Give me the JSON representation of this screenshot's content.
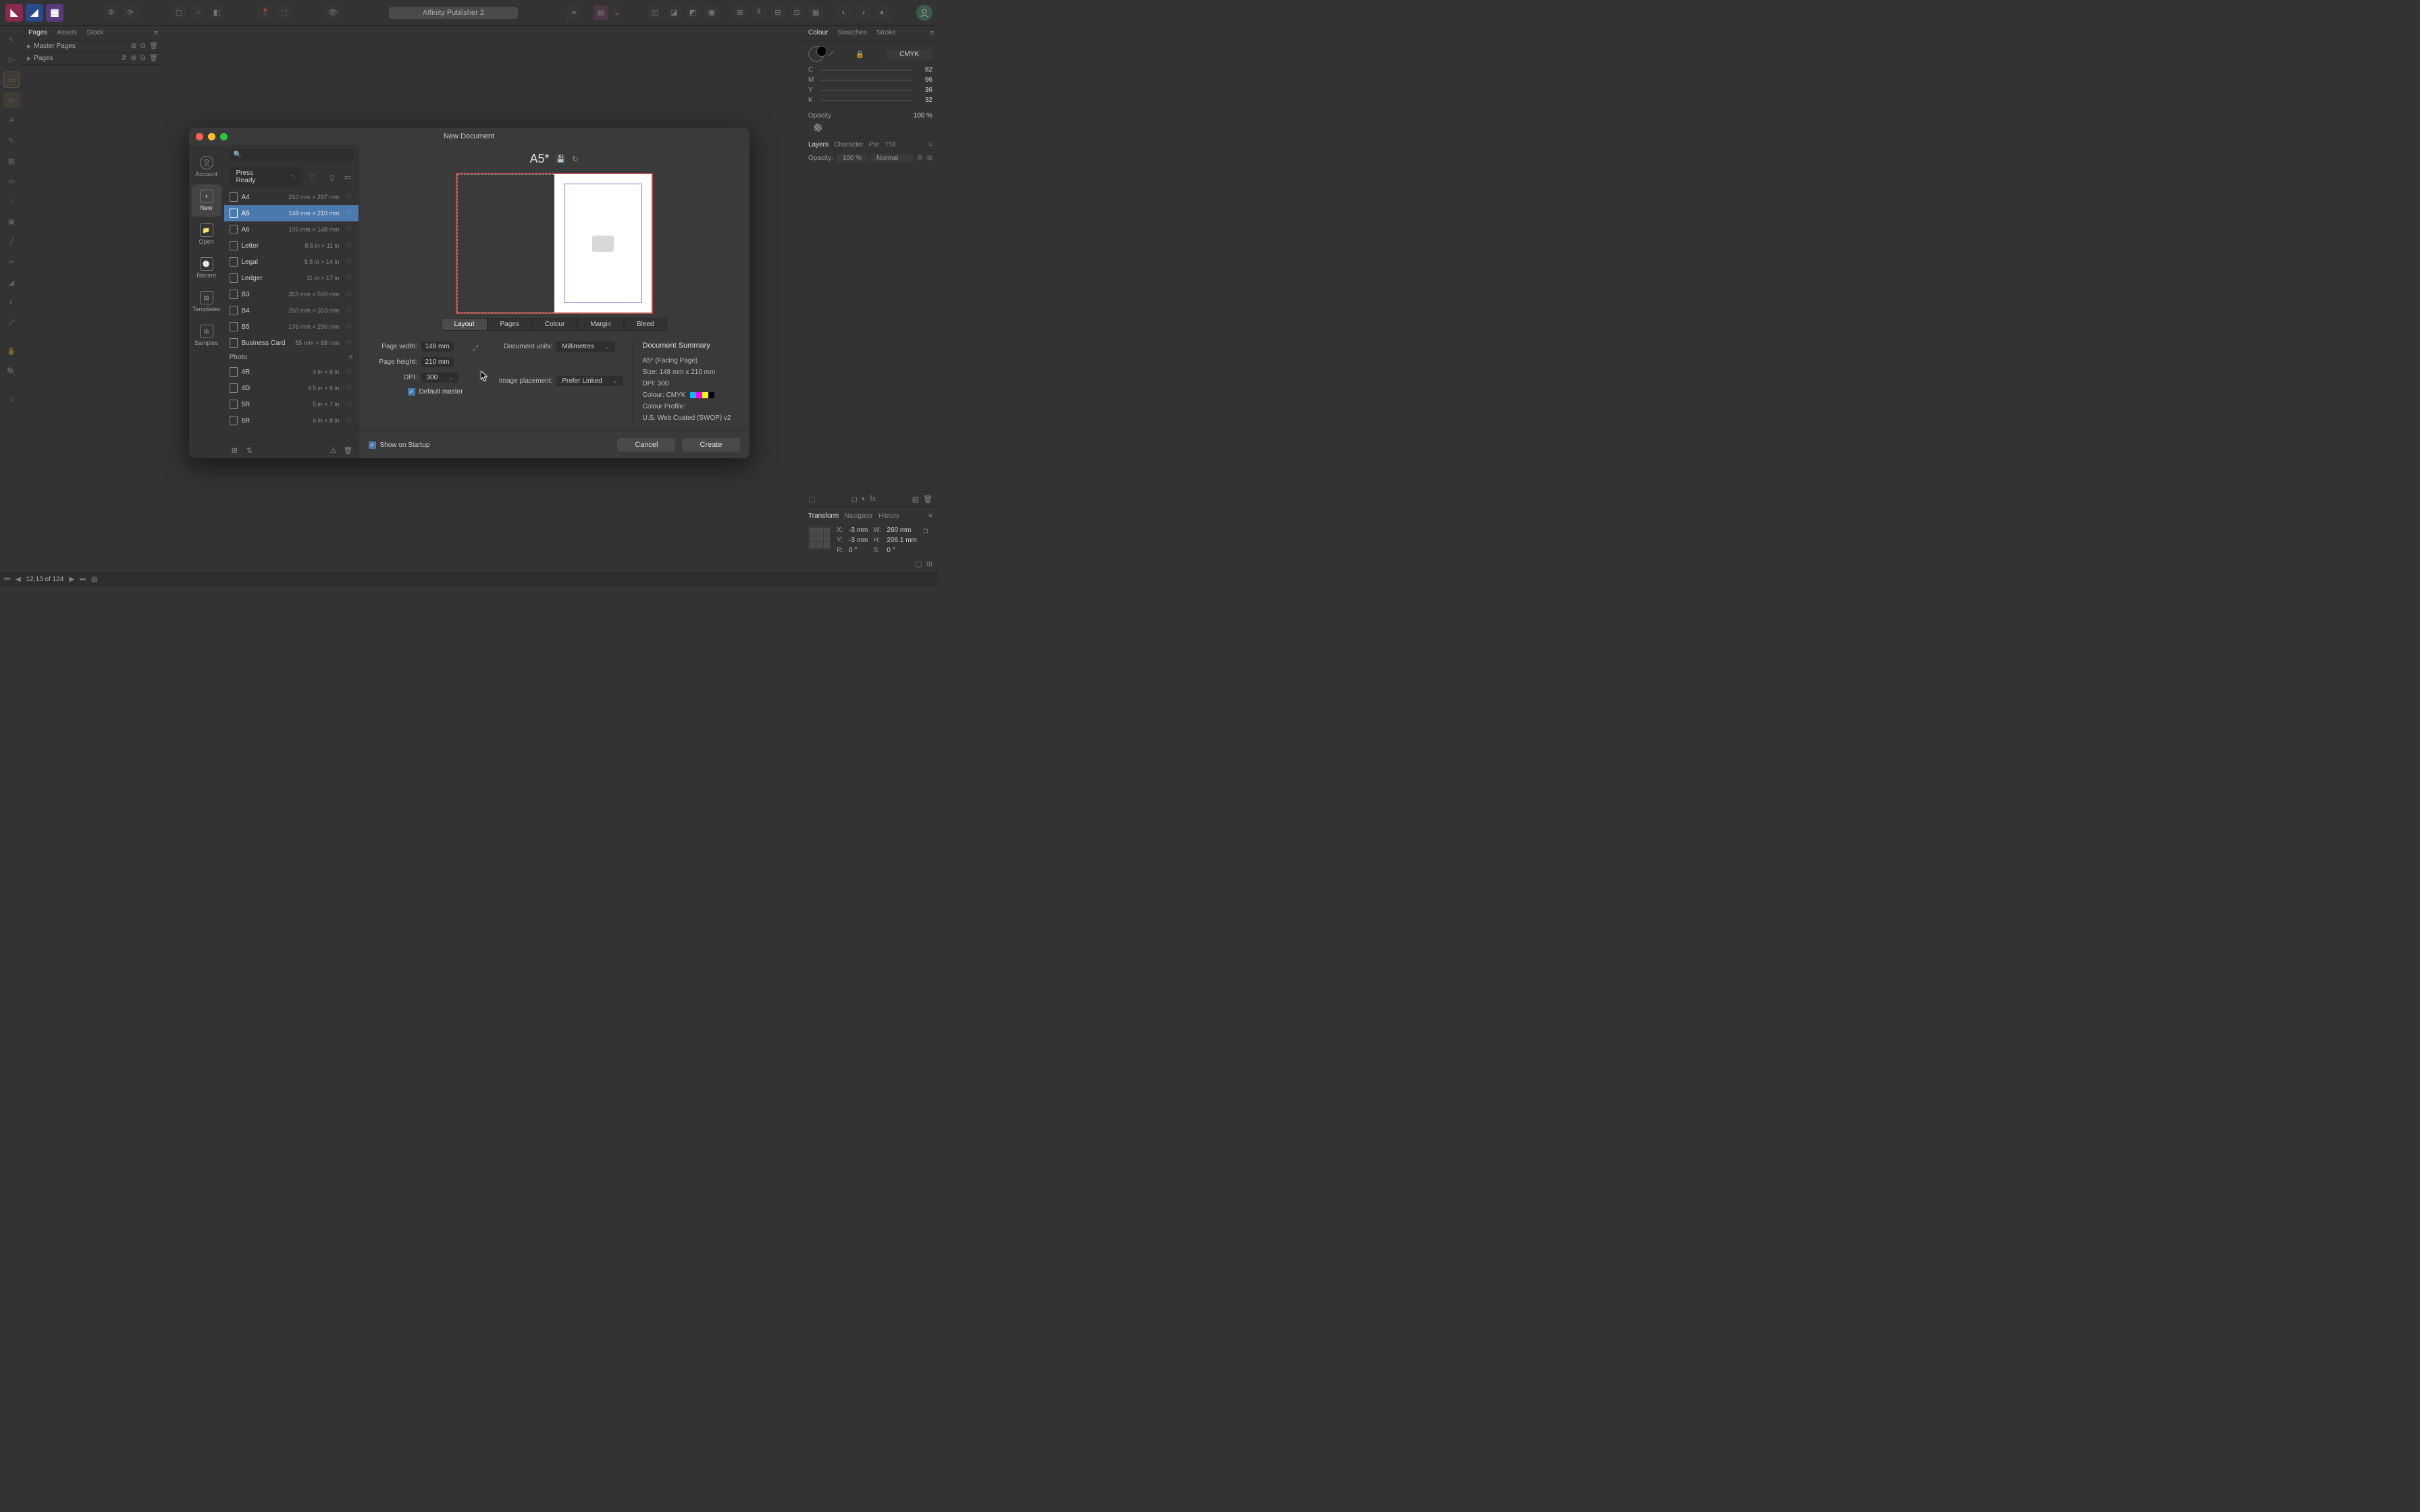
{
  "app_title": "Affinity Publisher 2",
  "app_switcher": [
    {
      "name": "photo",
      "bg": "#8b2a50",
      "letter": "▲"
    },
    {
      "name": "designer",
      "bg": "#2a4a8b",
      "letter": "◢"
    },
    {
      "name": "publisher",
      "bg": "#5a3a7a",
      "letter": "▣"
    }
  ],
  "left_panel": {
    "tabs": [
      "Pages",
      "Assets",
      "Stock"
    ],
    "active_tab": "Pages",
    "sections": [
      {
        "label": "Master Pages"
      },
      {
        "label": "Pages"
      }
    ]
  },
  "colour_panel": {
    "tabs": [
      "Colour",
      "Swatches",
      "Stroke"
    ],
    "mode": "CMYK",
    "sliders": [
      {
        "letter": "C",
        "val": "82"
      },
      {
        "letter": "M",
        "val": "96"
      },
      {
        "letter": "Y",
        "val": "36"
      },
      {
        "letter": "K",
        "val": "32"
      }
    ],
    "opacity_label": "Opacity",
    "opacity_value": "100 %"
  },
  "layers_panel": {
    "tabs": [
      "Layers",
      "Character",
      "Par",
      "TSt"
    ],
    "opacity_label": "Opacity:",
    "opacity_value": "100 %",
    "blend_mode": "Normal"
  },
  "transform_panel": {
    "tabs": [
      "Transform",
      "Navigator",
      "History"
    ],
    "x_label": "X:",
    "x_val": "-3 mm",
    "y_label": "Y:",
    "y_val": "-3 mm",
    "w_label": "W:",
    "w_val": "260 mm",
    "h_label": "H:",
    "h_val": "206.1 mm",
    "r_label": "R:",
    "r_val": "0 °",
    "s_label": "S:",
    "s_val": "0 °"
  },
  "status_bar": {
    "page_indicator": "12,13 of 124"
  },
  "dialog": {
    "title": "New Document",
    "sidebar": [
      {
        "id": "account",
        "label": "Account"
      },
      {
        "id": "new",
        "label": "New"
      },
      {
        "id": "open",
        "label": "Open"
      },
      {
        "id": "recent",
        "label": "Recent"
      },
      {
        "id": "templates",
        "label": "Templates"
      },
      {
        "id": "samples",
        "label": "Samples"
      }
    ],
    "active_sidebar": "new",
    "search_placeholder": "",
    "category_dropdown": "Press Ready",
    "presets": [
      {
        "name": "A4",
        "dims": "210 mm × 297 mm"
      },
      {
        "name": "A5",
        "dims": "148 mm × 210 mm"
      },
      {
        "name": "A6",
        "dims": "105 mm × 148 mm"
      },
      {
        "name": "Letter",
        "dims": "8.5 in × 11 in"
      },
      {
        "name": "Legal",
        "dims": "8.5 in × 14 in"
      },
      {
        "name": "Ledger",
        "dims": "11 in × 17 in"
      },
      {
        "name": "B3",
        "dims": "353 mm × 500 mm"
      },
      {
        "name": "B4",
        "dims": "250 mm × 353 mm"
      },
      {
        "name": "B5",
        "dims": "176 mm × 250 mm"
      },
      {
        "name": "Business Card",
        "dims": "55 mm × 88 mm"
      }
    ],
    "selected_preset": "A5",
    "photo_category_label": "Photo",
    "photo_presets": [
      {
        "name": "4R",
        "dims": "4 in × 6 in"
      },
      {
        "name": "4D",
        "dims": "4.5 in × 6 in"
      },
      {
        "name": "5R",
        "dims": "5 in × 7 in"
      },
      {
        "name": "6R",
        "dims": "6 in × 8 in"
      }
    ],
    "preview_title": "A5*",
    "settings_tabs": [
      "Layout",
      "Pages",
      "Colour",
      "Margin",
      "Bleed"
    ],
    "active_settings_tab": "Layout",
    "layout": {
      "page_width_label": "Page width:",
      "page_width_value": "148 mm",
      "page_height_label": "Page height:",
      "page_height_value": "210 mm",
      "dpi_label": "DPI:",
      "dpi_value": "300",
      "document_units_label": "Document units:",
      "document_units_value": "Millimetres",
      "image_placement_label": "Image placement:",
      "image_placement_value": "Prefer Linked",
      "default_master_label": "Default master"
    },
    "summary": {
      "title": "Document Summary",
      "lines": [
        "A5* (Facing Page)",
        "Size: 148 mm x 210 mm",
        "DPI:  300",
        "Colour: CMYK",
        "Colour Profile:",
        "U.S. Web Coated (SWOP) v2"
      ]
    },
    "show_on_startup_label": "Show on Startup",
    "cancel_label": "Cancel",
    "create_label": "Create"
  }
}
